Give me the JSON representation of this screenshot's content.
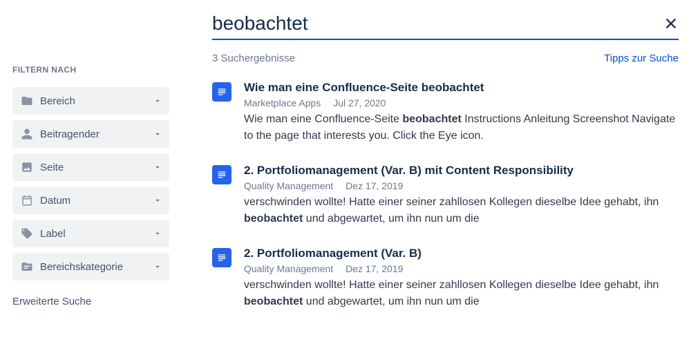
{
  "sidebar": {
    "title": "FILTERN NACH",
    "filters": [
      {
        "label": "Bereich"
      },
      {
        "label": "Beitragender"
      },
      {
        "label": "Seite"
      },
      {
        "label": "Datum"
      },
      {
        "label": "Label"
      },
      {
        "label": "Bereichskategorie"
      }
    ],
    "advanced": "Erweiterte Suche"
  },
  "search": {
    "query": "beobachtet",
    "count_text": "3 Suchergebnisse",
    "tips_link": "Tipps zur Suche"
  },
  "results": [
    {
      "title": "Wie man eine Confluence-Seite beobachtet",
      "space": "Marketplace Apps",
      "date": "Jul 27, 2020",
      "snippet_pre": "Wie man eine Confluence-Seite ",
      "snippet_hl": "beobachtet",
      "snippet_post": " Instructions Anleitung Screenshot Navigate to the page that interests you. Click the Eye icon."
    },
    {
      "title": "2. Portfoliomanagement (Var. B) mit Content Responsibility",
      "space": "Quality Management",
      "date": "Dez 17, 2019",
      "snippet_pre": "verschwinden wollte! Hatte einer seiner zahllosen Kollegen dieselbe Idee gehabt, ihn ",
      "snippet_hl": "beobachtet",
      "snippet_post": " und abgewartet, um ihn nun um die"
    },
    {
      "title": "2. Portfoliomanagement (Var. B)",
      "space": "Quality Management",
      "date": "Dez 17, 2019",
      "snippet_pre": "verschwinden wollte! Hatte einer seiner zahllosen Kollegen dieselbe Idee gehabt, ihn ",
      "snippet_hl": "beobachtet",
      "snippet_post": " und abgewartet, um ihn nun um die"
    }
  ]
}
